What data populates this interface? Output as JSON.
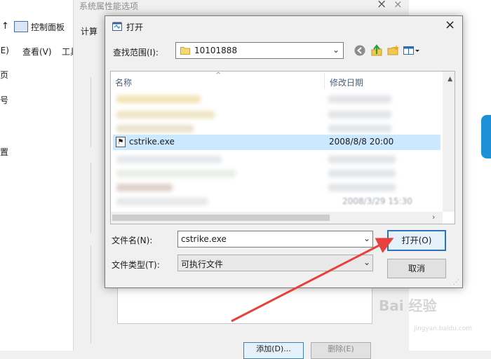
{
  "background_window": {
    "nav": {
      "back": "←",
      "forward": "→",
      "up": "↑"
    },
    "breadcrumb": "控制面板",
    "menu": {
      "edit": "(E)",
      "view": "查看(V)",
      "tools": "工具"
    },
    "sidebar": [
      "页",
      "号",
      "置"
    ]
  },
  "middle_window": {
    "title_a": "系统属",
    "title_b": "性能选项",
    "tab": "计算",
    "add_button": "添加(D)...",
    "delete_button": "删除(E)"
  },
  "dialog": {
    "title": "打开",
    "look_in_label": "查找范围(I):",
    "look_in_value": "10101888",
    "columns": {
      "name": "名称",
      "date": "修改日期"
    },
    "selected_file": {
      "name": "cstrike.exe",
      "date": "2008/8/8 20:00"
    },
    "blurred_date": "2008/3/29 15:30",
    "file_name_label": "文件名(N):",
    "file_name_value": "cstrike.exe",
    "file_type_label": "文件类型(T):",
    "file_type_value": "可执行文件",
    "open_button": "打开(O)",
    "cancel_button": "取消"
  },
  "colors": {
    "selection": "#cce8ff",
    "primary_border": "#2d73b8",
    "arrow": "#e8403d"
  },
  "icons": {
    "back": "back-icon",
    "up_folder": "up-folder-icon",
    "new_folder": "new-folder-icon",
    "view_menu": "view-menu-icon"
  },
  "watermark": {
    "text": "Bai 经验",
    "sub": "jingyan.baidu.com"
  }
}
